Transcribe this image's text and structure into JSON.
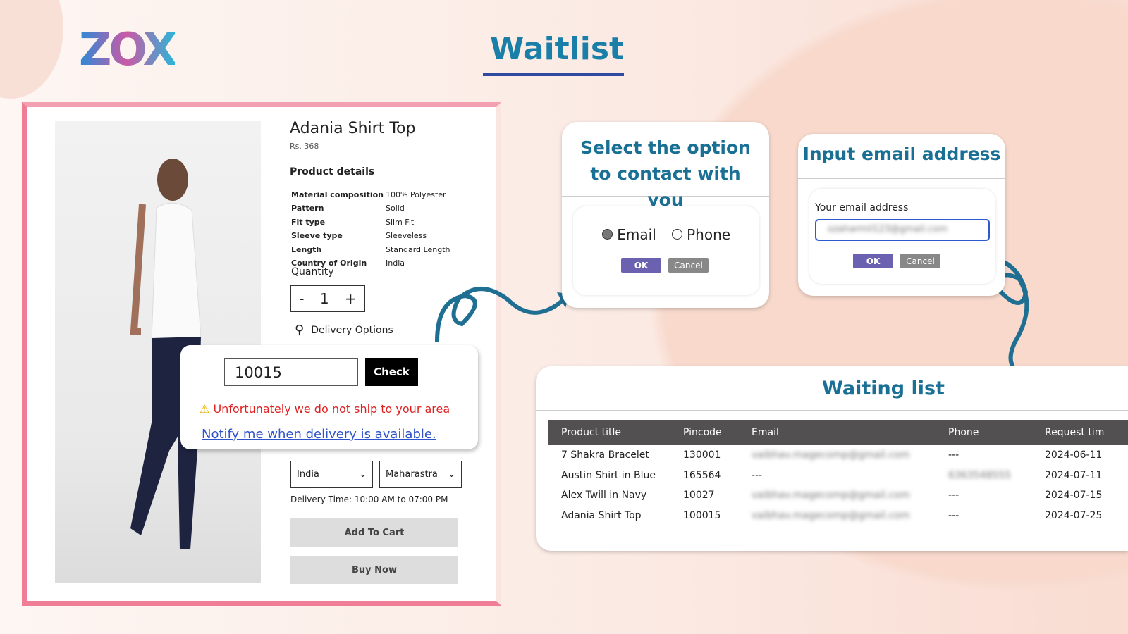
{
  "logo": "ZOX",
  "title": "Waitlist",
  "product": {
    "name": "Adania Shirt Top",
    "price": "Rs. 368",
    "details_heading": "Product details",
    "specs": [
      {
        "k": "Material composition",
        "v": "100% Polyester"
      },
      {
        "k": "Pattern",
        "v": "Solid"
      },
      {
        "k": "Fit type",
        "v": "Slim Fit"
      },
      {
        "k": "Sleeve type",
        "v": "Sleeveless"
      },
      {
        "k": "Length",
        "v": "Standard Length"
      },
      {
        "k": "Country of Origin",
        "v": "India"
      }
    ],
    "quantity_label": "Quantity",
    "quantity": "1",
    "minus": "-",
    "plus": "+",
    "delivery_options": "Delivery Options",
    "pincode": "10015",
    "check": "Check",
    "warning": "Unfortunately we do not ship to your area",
    "notify": "Notify me when delivery is available.",
    "country": "India",
    "state": "Maharastra",
    "delivery_time": "Delivery Time: 10:00 AM to 07:00 PM",
    "add_to_cart": "Add To Cart",
    "buy_now": "Buy Now"
  },
  "contact": {
    "heading": "Select the option to contact with you",
    "email": "Email",
    "phone": "Phone",
    "selected": "Email",
    "ok": "OK",
    "cancel": "Cancel"
  },
  "email_card": {
    "heading": "Input email address",
    "label": "Your email address",
    "value": "ozaharmil123@gmail.com",
    "ok": "OK",
    "cancel": "Cancel"
  },
  "waiting": {
    "heading": "Waiting list",
    "columns": [
      "Product title",
      "Pincode",
      "Email",
      "Phone",
      "Request tim"
    ],
    "rows": [
      [
        "7 Shakra Bracelet",
        "130001",
        "vaibhav.magecomp@gmail.com",
        "---",
        "2024-06-11"
      ],
      [
        "Austin Shirt in Blue",
        "165564",
        "---",
        "6363548555",
        "2024-07-11"
      ],
      [
        "Alex Twill in Navy",
        "10027",
        "vaibhav.magecomp@gmail.com",
        "---",
        "2024-07-15"
      ],
      [
        "Adania Shirt Top",
        "100015",
        "vaibhav.magecomp@gmail.com",
        "---",
        "2024-07-25"
      ]
    ]
  },
  "colors": {
    "accent": "#1a7fa8",
    "frame": "#ef7d95",
    "ok": "#6a62b0",
    "warning": "#e02020",
    "link": "#2e52c9"
  }
}
